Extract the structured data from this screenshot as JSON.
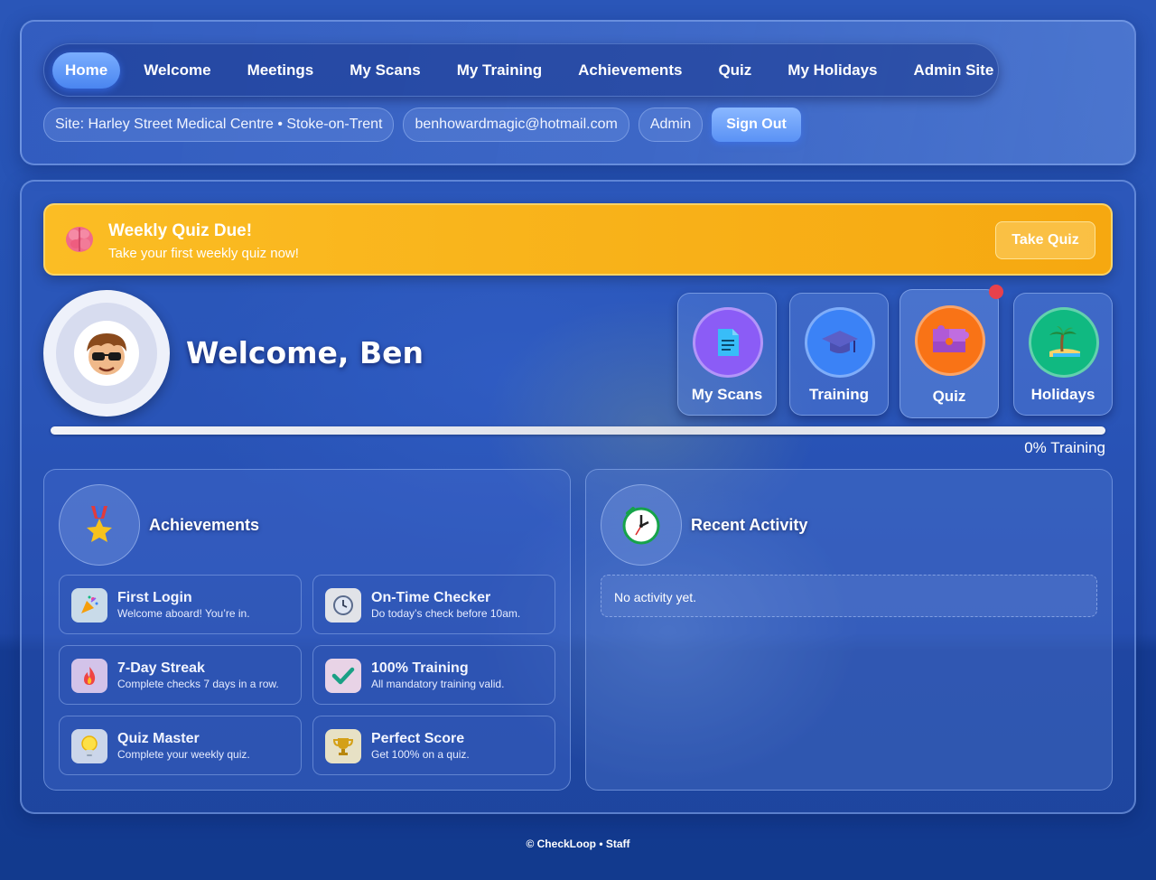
{
  "nav": {
    "items": [
      {
        "label": "Home",
        "active": true
      },
      {
        "label": "Welcome"
      },
      {
        "label": "Meetings"
      },
      {
        "label": "My Scans"
      },
      {
        "label": "My Training"
      },
      {
        "label": "Achievements"
      },
      {
        "label": "Quiz"
      },
      {
        "label": "My Holidays"
      },
      {
        "label": "Admin Site"
      }
    ]
  },
  "session": {
    "site": "Site: Harley Street Medical Centre • Stoke-on-Trent",
    "email": "benhowardmagic@hotmail.com",
    "role": "Admin",
    "sign_out": "Sign Out"
  },
  "banner": {
    "title": "Weekly Quiz Due!",
    "subtitle": "Take your first weekly quiz now!",
    "button": "Take Quiz",
    "icon": "brain-icon"
  },
  "welcome": {
    "text": "Welcome, Ben"
  },
  "tiles": [
    {
      "label": "My Scans",
      "icon": "document-icon",
      "color": "#8b5cf6"
    },
    {
      "label": "Training",
      "icon": "graduation-cap-icon",
      "color": "#3b82f6"
    },
    {
      "label": "Quiz",
      "icon": "puzzle-icon",
      "color": "#f97316",
      "badge": "!"
    },
    {
      "label": "Holidays",
      "icon": "palm-tree-icon",
      "color": "#10b981"
    }
  ],
  "training_progress": {
    "percent": 0,
    "label": "0% Training"
  },
  "achievements": {
    "title": "Achievements",
    "items": [
      {
        "title": "First Login",
        "desc": "Welcome aboard! You’re in.",
        "icon": "party-popper-icon",
        "bg": "#c9dbe9"
      },
      {
        "title": "On-Time Checker",
        "desc": "Do today’s check before 10am.",
        "icon": "clock-icon",
        "bg": "#e1e3e8"
      },
      {
        "title": "7-Day Streak",
        "desc": "Complete checks 7 days in a row.",
        "icon": "flame-icon",
        "bg": "#d3c3e9"
      },
      {
        "title": "100% Training",
        "desc": "All mandatory training valid.",
        "icon": "checkmark-icon",
        "bg": "#e8d3e6"
      },
      {
        "title": "Quiz Master",
        "desc": "Complete your weekly quiz.",
        "icon": "lightbulb-icon",
        "bg": "#cbd6ea"
      },
      {
        "title": "Perfect Score",
        "desc": "Get 100% on a quiz.",
        "icon": "trophy-icon",
        "bg": "#e7e1c5"
      }
    ]
  },
  "activity": {
    "title": "Recent Activity",
    "empty": "No activity yet."
  },
  "footer": "© CheckLoop • Staff"
}
